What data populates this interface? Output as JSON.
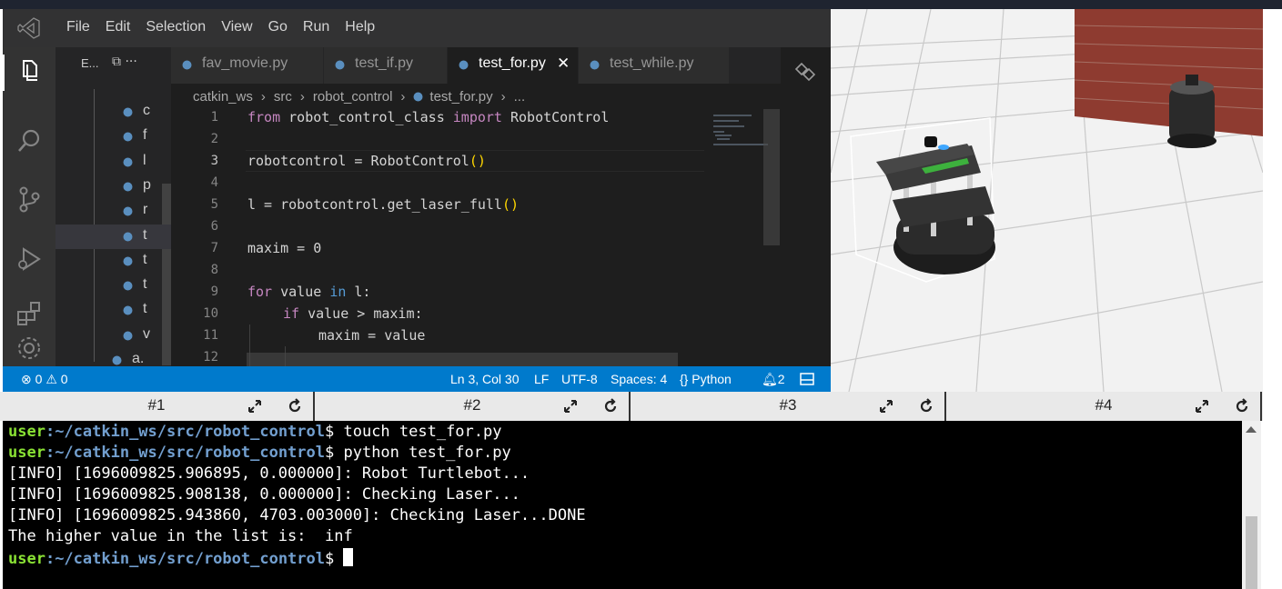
{
  "menubar": {
    "items": [
      "File",
      "Edit",
      "Selection",
      "View",
      "Go",
      "Run",
      "Help"
    ]
  },
  "explorer": {
    "title": "E...",
    "actions": "⧉ ···",
    "items": [
      "c",
      "f",
      "l",
      "p",
      "r",
      "t",
      "t",
      "t",
      "t",
      "v",
      "a."
    ]
  },
  "tabs": [
    {
      "label": "fav_movie.py",
      "active": false
    },
    {
      "label": "test_if.py",
      "active": false
    },
    {
      "label": "test_for.py",
      "active": true
    },
    {
      "label": "test_while.py",
      "active": false
    }
  ],
  "breadcrumb": [
    "catkin_ws",
    "src",
    "robot_control",
    "test_for.py",
    "..."
  ],
  "editor": {
    "line_numbers": [
      "1",
      "2",
      "3",
      "4",
      "5",
      "6",
      "7",
      "8",
      "9",
      "10",
      "11",
      "12"
    ],
    "code": {
      "l1_kw1": "from",
      "l1_mod": " robot_control_class ",
      "l1_kw2": "import",
      "l1_cls": " RobotControl",
      "l3_pre": "robotcontrol = RobotControl",
      "l3_paren": "()",
      "l5_pre": "l = robotcontrol.get_laser_full",
      "l5_paren": "()",
      "l7": "maxim = 0",
      "l9_kw1": "for",
      "l9_mid": " value ",
      "l9_kw2": "in",
      "l9_post": " l:",
      "l10_kw": "if",
      "l10_post": " value > maxim:",
      "l11": "maxim = value"
    }
  },
  "statusbar": {
    "errors": "0",
    "warnings": "0",
    "position": "Ln 3, Col 30",
    "eol": "LF",
    "encoding": "UTF-8",
    "spaces": "Spaces: 4",
    "language": "Python",
    "notifications": "2"
  },
  "terminal_tabs": [
    "#1",
    "#2",
    "#3",
    "#4"
  ],
  "terminal": {
    "user": "user",
    "path": ":~/catkin_ws/src/robot_control",
    "prompt": "$ ",
    "lines": [
      {
        "type": "prompt",
        "cmd": "touch test_for.py"
      },
      {
        "type": "prompt",
        "cmd": "python test_for.py"
      },
      {
        "type": "out",
        "text": "[INFO] [1696009825.906895, 0.000000]: Robot Turtlebot..."
      },
      {
        "type": "out",
        "text": "[INFO] [1696009825.908138, 0.000000]: Checking Laser..."
      },
      {
        "type": "out",
        "text": "[INFO] [1696009825.943860, 4703.003000]: Checking Laser...DONE"
      },
      {
        "type": "out",
        "text": "The higher value in the list is:  inf"
      },
      {
        "type": "prompt",
        "cmd": ""
      }
    ]
  },
  "colors": {
    "accent": "#007acc",
    "prompt_user": "#8ae234",
    "prompt_path": "#729fcf"
  }
}
